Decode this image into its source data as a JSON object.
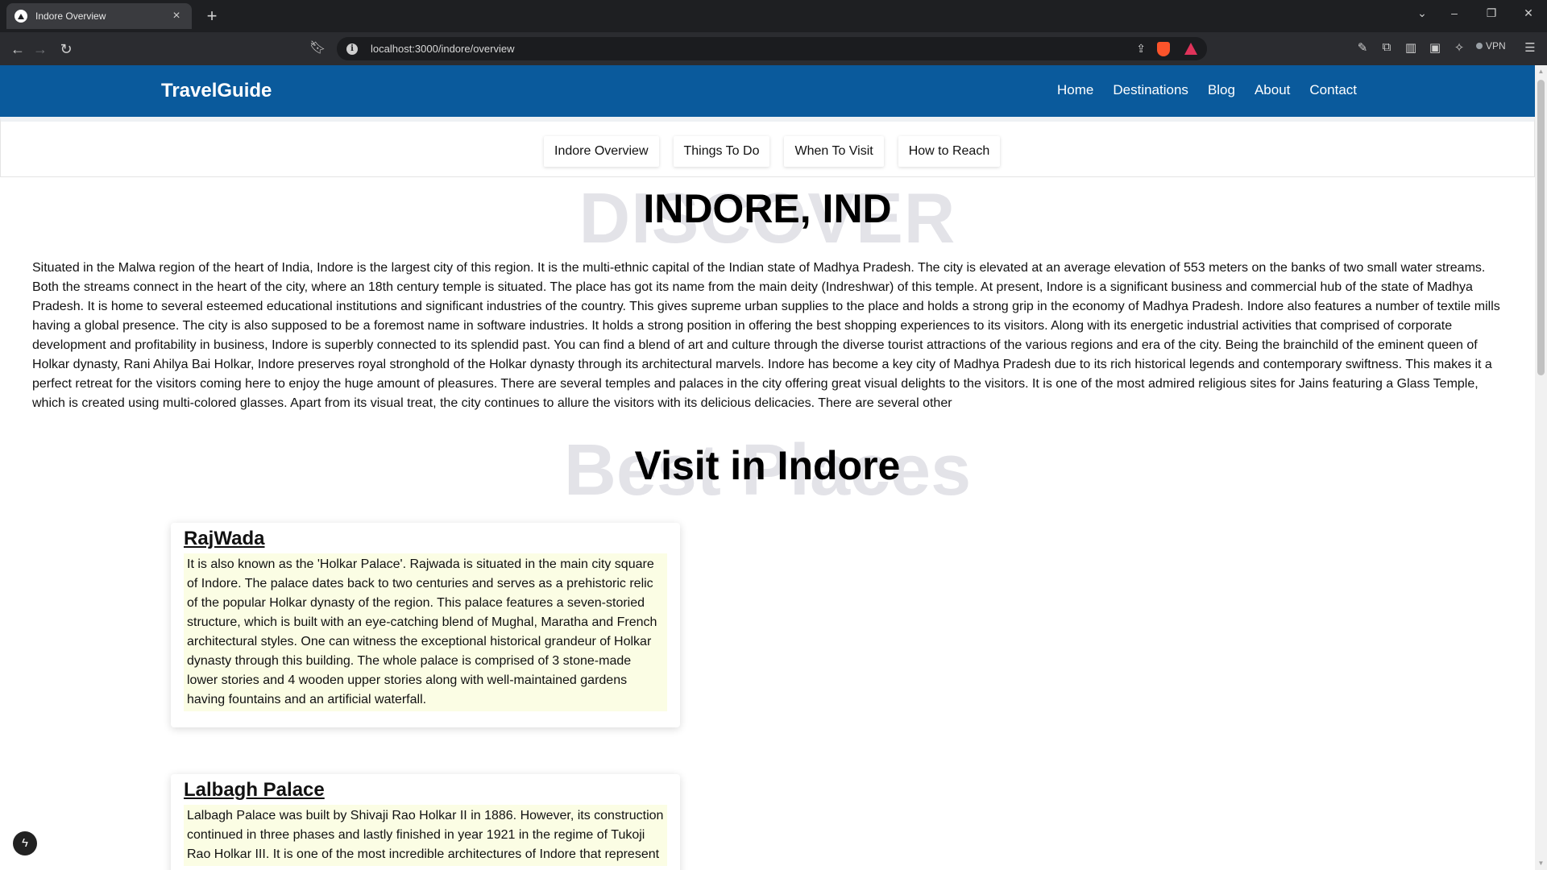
{
  "browser": {
    "tab_title": "Indore Overview",
    "tab_close": "×",
    "new_tab": "+",
    "url": "localhost:3000/indore/overview",
    "vpn_label": "VPN",
    "icons": [
      "back-icon",
      "forward-icon",
      "reload-icon",
      "bookmark-icon",
      "share-icon",
      "brave-shields-icon",
      "brave-rewards-icon",
      "brush-icon",
      "extensions-icon",
      "sidebar-icon",
      "wallet-icon",
      "leo-ai-icon",
      "menu-icon"
    ]
  },
  "header": {
    "brand": "TravelGuide",
    "nav": [
      "Home",
      "Destinations",
      "Blog",
      "About",
      "Contact"
    ],
    "color": "#0a5a9c"
  },
  "subnav": {
    "tabs": [
      "Indore Overview",
      "Things To Do",
      "When To Visit",
      "How to Reach"
    ]
  },
  "hero": {
    "background_word": "DISCOVER",
    "title": "INDORE, IND"
  },
  "intro": "Situated in the Malwa region of the heart of India, Indore is the largest city of this region. It is the multi-ethnic capital of the Indian state of Madhya Pradesh. The city is elevated at an average elevation of 553 meters on the banks of two small water streams. Both the streams connect in the heart of the city, where an 18th century temple is situated. The place has got its name from the main deity (Indreshwar) of this temple. At present, Indore is a significant business and commercial hub of the state of Madhya Pradesh. It is home to several esteemed educational institutions and significant industries of the country. This gives supreme urban supplies to the place and holds a strong grip in the economy of Madhya Pradesh. Indore also features a number of textile mills having a global presence. The city is also supposed to be a foremost name in software industries. It holds a strong position in offering the best shopping experiences to its visitors. Along with its energetic industrial activities that comprised of corporate development and profitability in business, Indore is superbly connected to its splendid past. You can find a blend of art and culture through the diverse tourist attractions of the various regions and era of the city. Being the brainchild of the eminent queen of Holkar dynasty, Rani Ahilya Bai Holkar, Indore preserves royal stronghold of the Holkar dynasty through its architectural marvels. Indore has become a key city of Madhya Pradesh due to its rich historical legends and contemporary swiftness. This makes it a perfect retreat for the visitors coming here to enjoy the huge amount of pleasures. There are several temples and palaces in the city offering great visual delights to the visitors. It is one of the most admired religious sites for Jains featuring a Glass Temple, which is created using multi-colored glasses. Apart from its visual treat, the city continues to allure the visitors with its delicious delicacies. There are several other",
  "places": {
    "background_word": "Best Places",
    "title": "Visit in Indore",
    "items": [
      {
        "name": "RajWada",
        "description": "It is also known as the 'Holkar Palace'. Rajwada is situated in the main city square of Indore. The palace dates back to two centuries and serves as a prehistoric relic of the popular Holkar dynasty of the region. This palace features a seven-storied structure, which is built with an eye-catching blend of Mughal, Maratha and French architectural styles. One can witness the exceptional historical grandeur of Holkar dynasty through this building. The whole palace is comprised of 3 stone-made lower stories and 4 wooden upper stories along with well-maintained gardens having fountains and an artificial waterfall."
      },
      {
        "name": "Lalbagh Palace",
        "description": "Lalbagh Palace was built by Shivaji Rao Holkar II in 1886. However, its construction continued in three phases and lastly finished in year 1921 in the regime of Tukoji Rao Holkar III. It is one of the most incredible architectures of Indore that represent"
      }
    ]
  },
  "fab_icon": "lightning-icon"
}
